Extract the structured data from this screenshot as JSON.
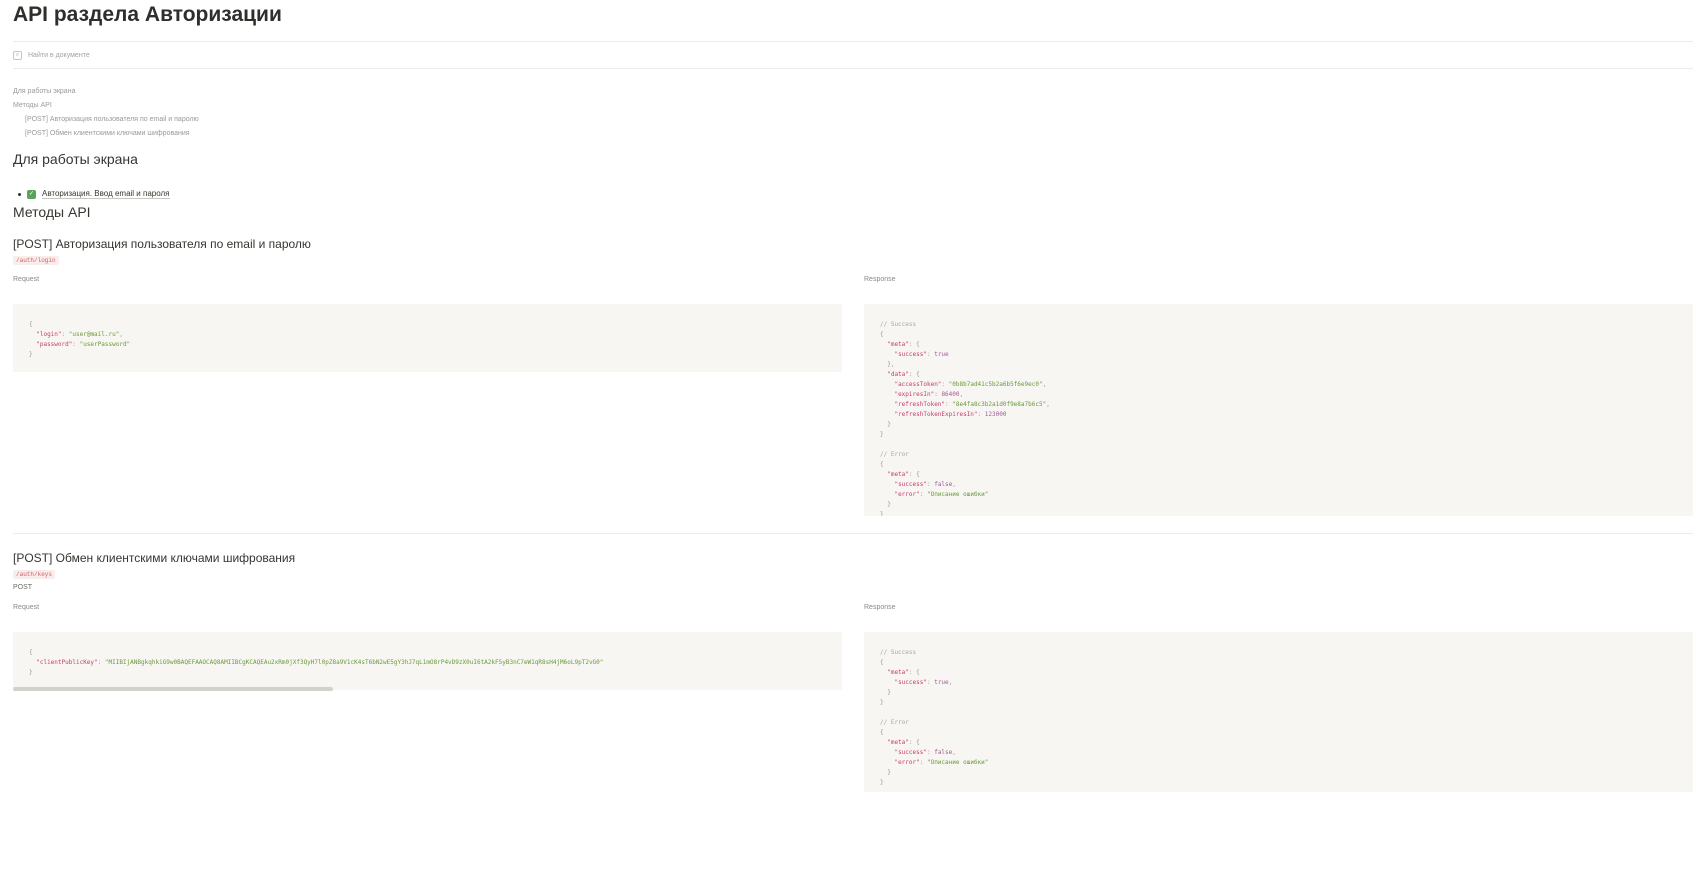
{
  "title": "API раздела Авторизации",
  "search": {
    "placeholder": "Найти в документе"
  },
  "toc": {
    "items": [
      "Для работы экрана",
      "Методы API",
      "[POST] Авторизация пользователя по email и паролю",
      "[POST] Обмен клиентскими ключами шифрования"
    ]
  },
  "section_screen": {
    "heading": "Для работы экрана",
    "link_label": "Авторизация. Ввод email и пароля"
  },
  "section_methods": {
    "heading": "Методы API"
  },
  "method1": {
    "title": "[POST] Авторизация пользователя по email и паролю",
    "tag": "/auth/login",
    "request_label": "Request",
    "response_label": "Response",
    "request_lines": [
      "{",
      "  \"login\": \"user@mail.ru\",",
      "  \"password\": \"userPassword\"",
      "}"
    ],
    "response_lines": [
      "// Success",
      "{",
      "  \"meta\": {",
      "    \"success\": true",
      "  },",
      "  \"data\": {",
      "    \"accessToken\": \"0b8b7ad41c5b2a6b5f6e9ec0\",",
      "    \"expiresIn\": 86400,",
      "    \"refreshToken\": \"8e4fa8c3b2a1d0f9e8a7b6c5\",",
      "    \"refreshTokenExpiresIn\": 123000",
      "  }",
      "}",
      "",
      "// Error",
      "{",
      "  \"meta\": {",
      "    \"success\": false,",
      "    \"error\": \"Описание ошибки\"",
      "  }",
      "}"
    ]
  },
  "method2": {
    "title": "[POST] Обмен клиентскими ключами шифрования",
    "tag": "/auth/keys",
    "method_text": "POST",
    "request_label": "Request",
    "response_label": "Response",
    "request_lines": [
      "{",
      "  \"clientPublicKey\": \"MIIBIjANBgkqhkiG9w0BAQEFAAOCAQ8AMIIBCgKCAQEAu2xRm0jXf3QyH7l0pZ8a9V1cK4sT6bN2wE5gY3hJ7qL1mO8rP4vD9zX0uI6tA2kF5yB3nC7eW1qR8sH4jM6oL9pT2vG0\"",
      "}"
    ],
    "response_lines": [
      "// Success",
      "{",
      "  \"meta\": {",
      "    \"success\": true,",
      "  }",
      "}",
      "",
      "// Error",
      "{",
      "  \"meta\": {",
      "    \"success\": false,",
      "    \"error\": \"Описание ошибки\"",
      "  }",
      "}"
    ]
  }
}
